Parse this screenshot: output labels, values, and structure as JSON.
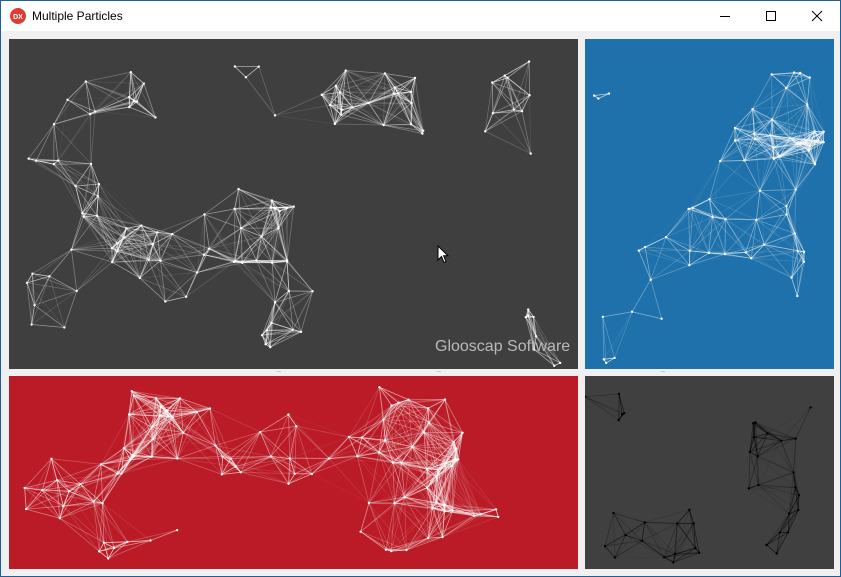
{
  "window": {
    "title": "Multiple Particles",
    "app_icon_label": "DX",
    "controls": {
      "minimize": "minimize-icon",
      "maximize": "maximize-icon",
      "close": "close-icon"
    }
  },
  "panels": [
    {
      "id": "main",
      "background": "#3f3f3f",
      "line_color": "#ffffff"
    },
    {
      "id": "blue",
      "background": "#1e71aa",
      "line_color": "#ffffff"
    },
    {
      "id": "red",
      "background": "#ba1b26",
      "line_color": "#ffffff"
    },
    {
      "id": "dark",
      "background": "#404040",
      "line_color": "#000000"
    }
  ],
  "watermark": "Glooscap Software",
  "colors": {
    "accent_border": "#1f5f96",
    "icon_red": "#e03c31"
  }
}
